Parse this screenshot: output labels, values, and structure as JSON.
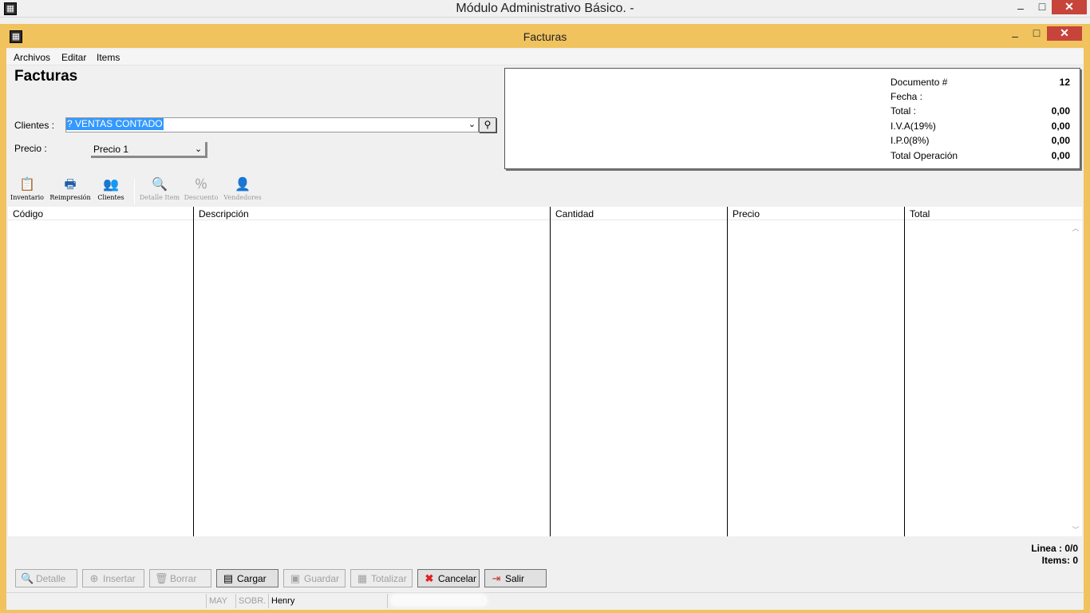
{
  "outer_window": {
    "title": "Módulo Administrativo Básico. -",
    "minimize": "–",
    "maximize": "□",
    "close": "✕"
  },
  "inner_window": {
    "title": "Facturas",
    "minimize": "–",
    "maximize": "□",
    "close": "✕"
  },
  "menu": [
    "Archivos",
    "Editar",
    "Items"
  ],
  "form": {
    "title": "Facturas",
    "clientes_label": "Clientes :",
    "clientes_value": "? VENTAS CONTADO",
    "precio_label": "Precio :",
    "precio_value": "Precio 1"
  },
  "summary": {
    "rows": [
      {
        "label": "Documento #",
        "value": "12"
      },
      {
        "label": "Fecha :",
        "value": ""
      },
      {
        "label": "Total :",
        "value": "0,00"
      },
      {
        "label": "I.V.A(19%)",
        "value": "0,00"
      },
      {
        "label": "I.P.0(8%)",
        "value": "0,00"
      },
      {
        "label": "Total Operación",
        "value": "0,00"
      }
    ]
  },
  "toolbar": [
    {
      "label": "Inventario",
      "icon": "clipboard-icon",
      "glyph": "📋",
      "enabled": true
    },
    {
      "label": "Reimpresión",
      "icon": "printer-icon",
      "glyph": "🖶",
      "enabled": true
    },
    {
      "label": "Clientes",
      "icon": "users-icon",
      "glyph": "👥",
      "enabled": true
    },
    {
      "label": "Detalle Item",
      "icon": "magnifier-doc-icon",
      "glyph": "🔍",
      "enabled": false
    },
    {
      "label": "Descuento",
      "icon": "percent-doc-icon",
      "glyph": "％",
      "enabled": false
    },
    {
      "label": "Vendedores",
      "icon": "salesperson-icon",
      "glyph": "👤",
      "enabled": false
    }
  ],
  "grid": {
    "columns": [
      "Código",
      "Descripción",
      "Cantidad",
      "Precio",
      "Total"
    ],
    "rows": []
  },
  "counters": {
    "linea": "Linea : 0/0",
    "items": "Items: 0"
  },
  "buttons": [
    {
      "label": "Detalle",
      "icon": "magnifier-icon",
      "glyph": "🔍",
      "enabled": false
    },
    {
      "label": "Insertar",
      "icon": "insert-icon",
      "glyph": "⊕",
      "enabled": false
    },
    {
      "label": "Borrar",
      "icon": "trash-icon",
      "glyph": "🗑",
      "enabled": false
    },
    {
      "label": "Cargar",
      "icon": "load-doc-icon",
      "glyph": "▤",
      "enabled": true
    },
    {
      "label": "Guardar",
      "icon": "save-doc-icon",
      "glyph": "▣",
      "enabled": false
    },
    {
      "label": "Totalizar",
      "icon": "calculator-icon",
      "glyph": "▦",
      "enabled": false
    },
    {
      "label": "Cancelar",
      "icon": "red-x-icon",
      "glyph": "✖",
      "enabled": true
    },
    {
      "label": "Salir",
      "icon": "exit-door-icon",
      "glyph": "⇥",
      "enabled": true
    }
  ],
  "statusbar": {
    "caps": "MAY",
    "overwrite": "SOBR.",
    "user": "Henry"
  },
  "colors": {
    "mdi_frame": "#f0c35f",
    "selection": "#3399ff",
    "close_button": "#c7443a",
    "cancel_icon": "#e02020"
  }
}
